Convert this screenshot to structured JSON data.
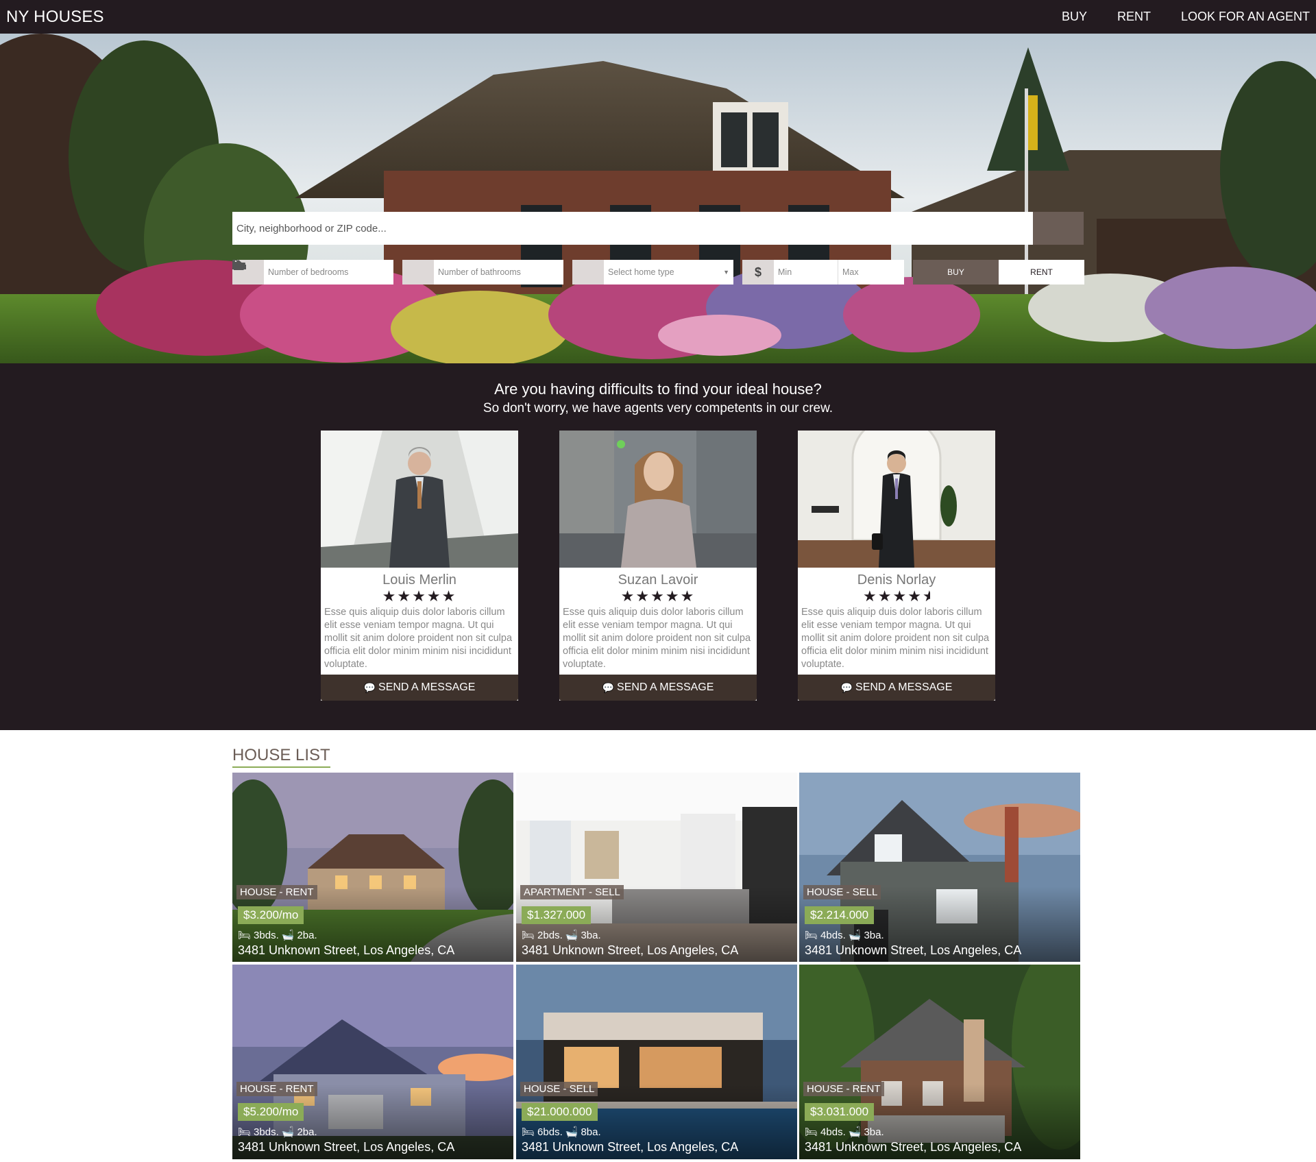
{
  "nav": {
    "brand": "NY HOUSES",
    "links": [
      "BUY",
      "RENT",
      "LOOK FOR AN AGENT"
    ]
  },
  "search": {
    "placeholder": "City, neighborhood or ZIP code...",
    "bedrooms_placeholder": "Number of bedrooms",
    "bathrooms_placeholder": "Number of bathrooms",
    "home_type_placeholder": "Select home type",
    "min_placeholder": "Min",
    "max_placeholder": "Max",
    "buy_label": "BUY",
    "rent_label": "RENT",
    "selected_mode": "BUY"
  },
  "agents": {
    "title": "Are you having difficults to find your ideal house?",
    "subtitle": "So don't worry, we have agents very competents in our crew.",
    "button_label": "SEND A MESSAGE",
    "items": [
      {
        "name": "Louis Merlin",
        "rating": 5,
        "bio": "Esse quis aliquip duis dolor laboris cillum elit esse veniam tempor magna. Ut qui mollit sit anim dolore proident non sit culpa officia elit dolor minim minim nisi incididunt voluptate."
      },
      {
        "name": "Suzan Lavoir",
        "rating": 5,
        "bio": "Esse quis aliquip duis dolor laboris cillum elit esse veniam tempor magna. Ut qui mollit sit anim dolore proident non sit culpa officia elit dolor minim minim nisi incididunt voluptate."
      },
      {
        "name": "Denis Norlay",
        "rating": 4.5,
        "bio": "Esse quis aliquip duis dolor laboris cillum elit esse veniam tempor magna. Ut qui mollit sit anim dolore proident non sit culpa officia elit dolor minim minim nisi incididunt voluptate."
      }
    ]
  },
  "houses": {
    "title": "HOUSE LIST",
    "items": [
      {
        "tag": "HOUSE - RENT",
        "price": "$3.200/mo",
        "beds": "3bds.",
        "baths": "2ba.",
        "address": "3481 Unknown Street, Los Angeles, CA"
      },
      {
        "tag": "APARTMENT - SELL",
        "price": "$1.327.000",
        "beds": "2bds.",
        "baths": "3ba.",
        "address": "3481 Unknown Street, Los Angeles, CA"
      },
      {
        "tag": "HOUSE - SELL",
        "price": "$2.214.000",
        "beds": "4bds.",
        "baths": "3ba.",
        "address": "3481 Unknown Street, Los Angeles, CA"
      },
      {
        "tag": "HOUSE - RENT",
        "price": "$5.200/mo",
        "beds": "3bds.",
        "baths": "2ba.",
        "address": "3481 Unknown Street, Los Angeles, CA"
      },
      {
        "tag": "HOUSE - SELL",
        "price": "$21.000.000",
        "beds": "6bds.",
        "baths": "8ba.",
        "address": "3481 Unknown Street, Los Angeles, CA"
      },
      {
        "tag": "HOUSE - RENT",
        "price": "$3.031.000",
        "beds": "4bds.",
        "baths": "3ba.",
        "address": "3481 Unknown Street, Los Angeles, CA"
      }
    ]
  },
  "colors": {
    "dark": "#231b20",
    "accent_brown": "#6b5d56",
    "accent_green": "#8bab57"
  },
  "icons": {
    "search": "search-icon",
    "bed": "bed-icon",
    "bath": "bath-icon",
    "home": "home-icon",
    "dollar": "dollar-icon",
    "chat": "chat-icon",
    "star": "star-icon"
  }
}
